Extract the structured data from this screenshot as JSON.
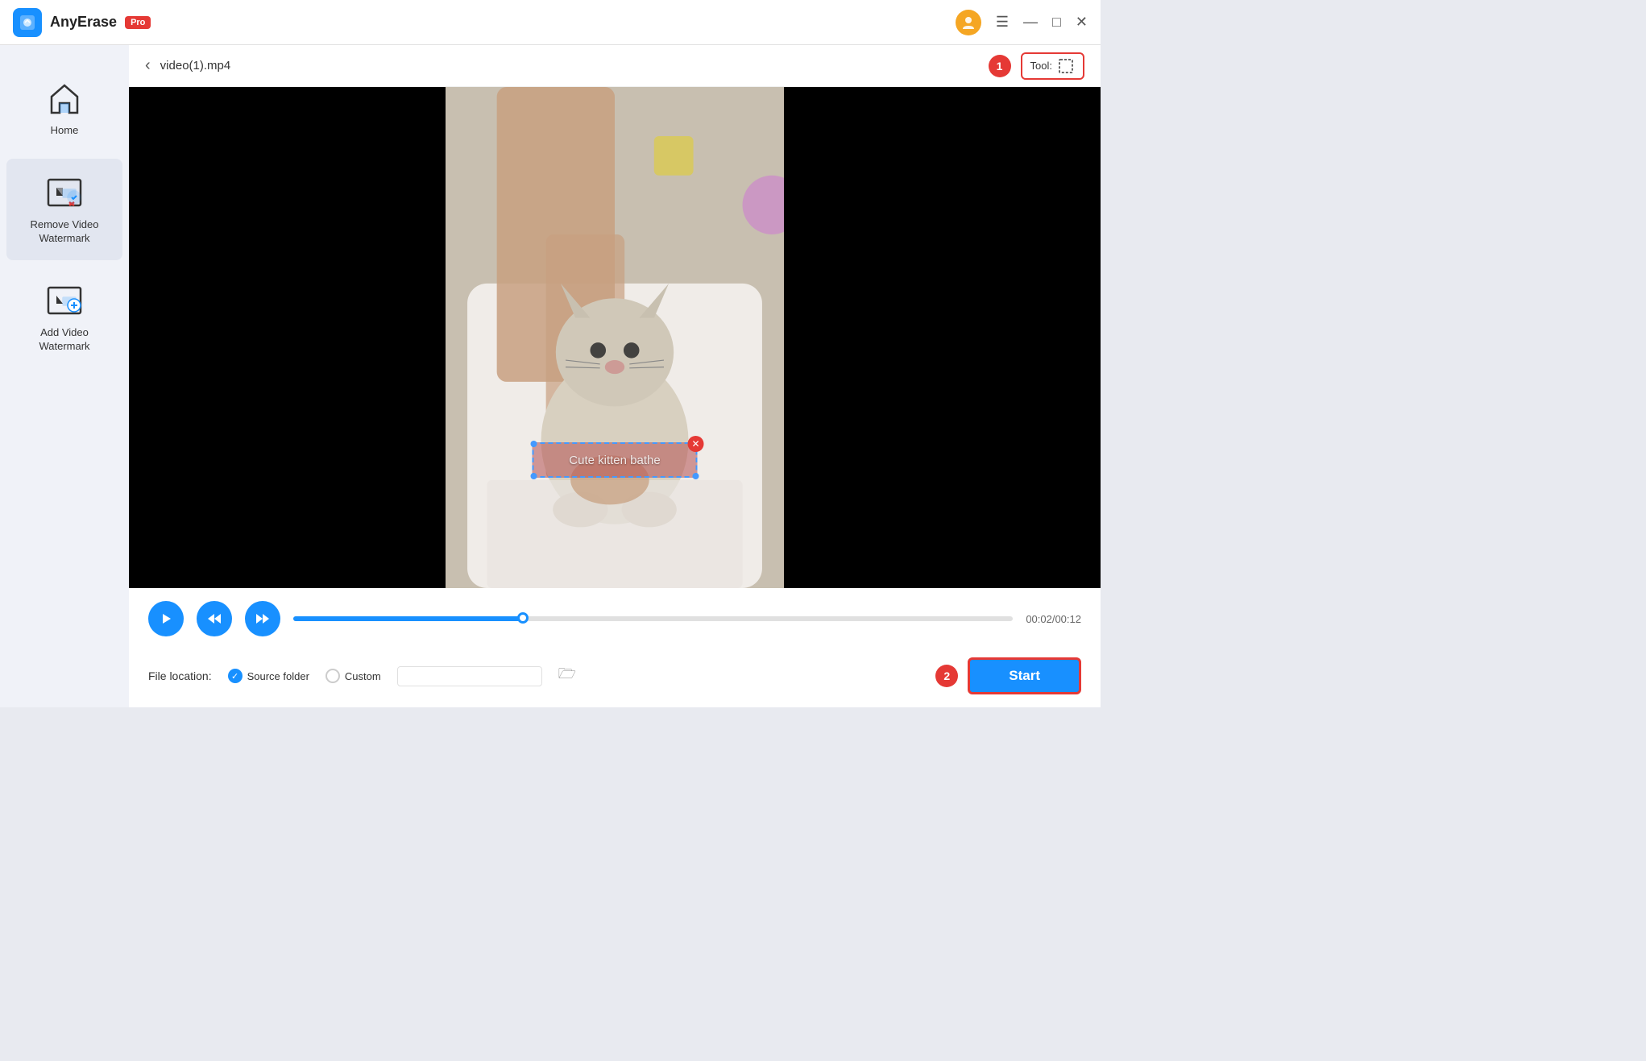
{
  "titlebar": {
    "app_name": "AnyErase",
    "pro_badge": "Pro",
    "win_controls": [
      "menu-icon",
      "minimize-icon",
      "maximize-icon",
      "close-icon"
    ]
  },
  "sidebar": {
    "items": [
      {
        "id": "home",
        "label": "Home",
        "active": false
      },
      {
        "id": "remove-watermark",
        "label": "Remove Video\nWatermark",
        "active": true
      },
      {
        "id": "add-watermark",
        "label": "Add Video\nWatermark",
        "active": false
      }
    ]
  },
  "content_header": {
    "back_label": "‹",
    "file_name": "video(1).mp4",
    "step1_label": "1",
    "tool_label": "Tool:",
    "tool_icon": "crop-icon"
  },
  "video": {
    "watermark_text": "Cute kitten bathe"
  },
  "controls": {
    "time_current": "00:02",
    "time_total": "00:12",
    "time_display": "00:02/00:12"
  },
  "file_location": {
    "label": "File location:",
    "source_folder_label": "Source folder",
    "custom_label": "Custom",
    "custom_placeholder": "",
    "step2_label": "2",
    "start_label": "Start"
  }
}
